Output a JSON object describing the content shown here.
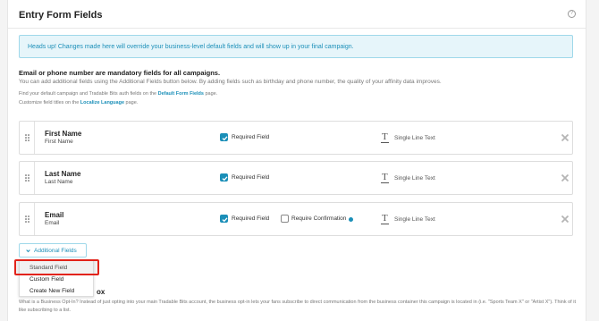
{
  "page": {
    "title": "Entry Form Fields",
    "help_icon": "?"
  },
  "notice": "Heads up! Changes made here will override your business-level default fields and will show up in your final campaign.",
  "intro": {
    "mandatory": "Email or phone number are mandatory fields for all campaigns.",
    "description": "You can add additional fields using the Additional Fields button below. By adding fields such as birthday and phone number, the quality of your affinity data improves.",
    "find_prefix": "Find your default campaign and Tradable Bits auth fields on the ",
    "find_link": "Default Form Fields",
    "find_suffix": " page.",
    "customize_prefix": "Customize field titles on the ",
    "customize_link": "Localize Language",
    "customize_suffix": " page."
  },
  "fields": [
    {
      "name": "First Name",
      "sub": "First Name",
      "required_label": "Required Field",
      "required": true,
      "type_label": "Single Line Text",
      "type_icon": "T"
    },
    {
      "name": "Last Name",
      "sub": "Last Name",
      "required_label": "Required Field",
      "required": true,
      "type_label": "Single Line Text",
      "type_icon": "T"
    },
    {
      "name": "Email",
      "sub": "Email",
      "required_label": "Required Field",
      "required": true,
      "confirm_label": "Require Confirmation",
      "confirm": false,
      "type_label": "Single Line Text",
      "type_icon": "T"
    }
  ],
  "additional_fields": {
    "button_label": "Additional Fields",
    "menu": [
      "Standard Field",
      "Custom Field",
      "Create New Field"
    ],
    "highlighted": "Standard Field"
  },
  "optin": {
    "heading_partial": "ox",
    "description": "What is a Business Opt-In? Instead of just opting into your main Tradable Bits account, the business opt-in lets your fans subscribe to direct communication from the business container this campaign is located in (i.e. \"Sports Team X\" or \"Artist X\"). Think of it like subscribing to a list."
  },
  "colors": {
    "accent": "#1b8fb8",
    "notice_bg": "#e6f5fa",
    "highlight_border": "#e2231a"
  }
}
